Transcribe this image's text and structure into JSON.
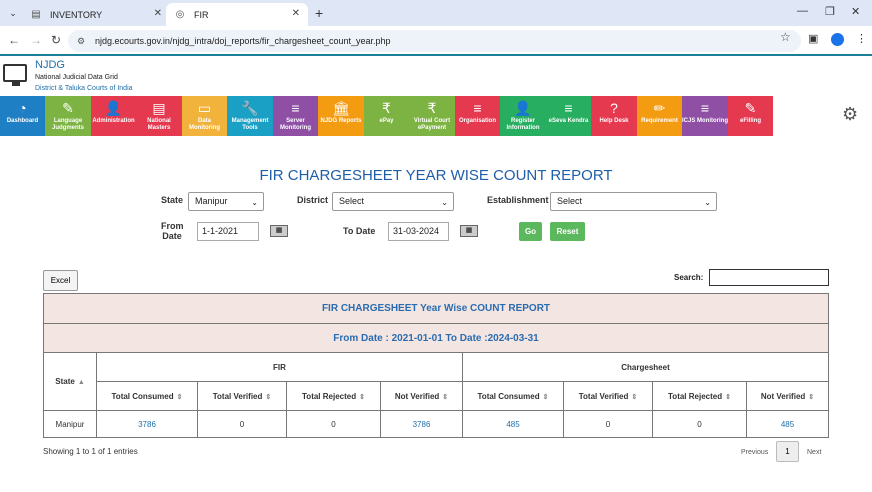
{
  "browser": {
    "tabs": [
      {
        "label": "INVENTORY",
        "active": false
      },
      {
        "label": "FIR",
        "active": true
      }
    ],
    "url": "njdg.ecourts.gov.in/njdg_intra/doj_reports/fir_chargesheet_count_year.php"
  },
  "header": {
    "brand": "NJDG",
    "subtitle": "National Judicial Data Grid",
    "subtitle2": "District & Taluka Courts of India"
  },
  "menu": [
    {
      "label": "Dashboard",
      "color": "#1f7fc4",
      "icon": "dashboard-icon"
    },
    {
      "label": "Language Judgments",
      "color": "#7cb342",
      "icon": "edit-icon"
    },
    {
      "label": "Administration",
      "color": "#e53950",
      "icon": "user-icon"
    },
    {
      "label": "National Masters",
      "color": "#e53950",
      "icon": "document-icon"
    },
    {
      "label": "Data Monitoring",
      "color": "#f2b33d",
      "icon": "monitor-icon"
    },
    {
      "label": "Management Tools",
      "color": "#1aa0c5",
      "icon": "wrench-icon"
    },
    {
      "label": "Server Monitoring",
      "color": "#8e4fa5",
      "icon": "server-icon"
    },
    {
      "label": "NJDG Reports",
      "color": "#f39c12",
      "icon": "bank-icon"
    },
    {
      "label": "ePay",
      "color": "#7cb342",
      "icon": "rupee-icon"
    },
    {
      "label": "Virtual Court ePayment",
      "color": "#7cb342",
      "icon": "rupee-icon"
    },
    {
      "label": "Organisation",
      "color": "#e53950",
      "icon": "server-icon"
    },
    {
      "label": "Register Information",
      "color": "#27ae60",
      "icon": "user-icon"
    },
    {
      "label": "eSeva Kendra",
      "color": "#27ae60",
      "icon": "server-icon"
    },
    {
      "label": "Help Desk",
      "color": "#e53950",
      "icon": "question-icon"
    },
    {
      "label": "Requirement",
      "color": "#f39c12",
      "icon": "pencil-icon"
    },
    {
      "label": "ICJS Monitoring",
      "color": "#8e4fa5",
      "icon": "server-icon"
    },
    {
      "label": "eFilling",
      "color": "#e53950",
      "icon": "edit-icon"
    }
  ],
  "report": {
    "title": "FIR CHARGESHEET YEAR WISE COUNT REPORT",
    "filters": {
      "state_label": "State",
      "state_value": "Manipur",
      "district_label": "District",
      "district_value": "Select",
      "establishment_label": "Establishment",
      "establishment_value": "Select",
      "from_label": "From Date",
      "from_value": "1-1-2021",
      "to_label": "To Date",
      "to_value": "31-03-2024",
      "go_label": "Go",
      "reset_label": "Reset"
    },
    "excel_label": "Excel",
    "search_label": "Search:",
    "table_title": "FIR CHARGESHEET Year Wise COUNT REPORT",
    "table_date_range": "From Date : 2021-01-01   To Date :2024-03-31",
    "col_state": "State",
    "group_fir": "FIR",
    "group_chargesheet": "Chargesheet",
    "subcols": [
      "Total Consumed",
      "Total Verified",
      "Total Rejected",
      "Not Verified",
      "Total Consumed",
      "Total Verified",
      "Total Rejected",
      "Not Verified"
    ],
    "rows": [
      {
        "state": "Manipur",
        "values": [
          "3786",
          "0",
          "0",
          "3786",
          "485",
          "0",
          "0",
          "485"
        ]
      }
    ],
    "footer_info": "Showing 1 to 1 of 1 entries",
    "pagination": {
      "previous": "Previous",
      "current": "1",
      "next": "Next"
    }
  }
}
